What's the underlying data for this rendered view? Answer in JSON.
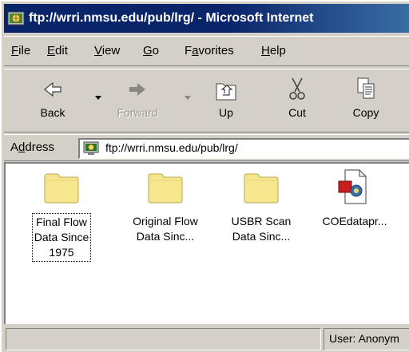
{
  "window": {
    "title": "ftp://wrri.nmsu.edu/pub/lrg/ - Microsoft Internet"
  },
  "menu": {
    "items": [
      {
        "label": "File",
        "underline": "F"
      },
      {
        "label": "Edit",
        "underline": "E"
      },
      {
        "label": "View",
        "underline": "V"
      },
      {
        "label": "Go",
        "underline": "G"
      },
      {
        "label": "Favorites",
        "underline": "a"
      },
      {
        "label": "Help",
        "underline": "H"
      }
    ]
  },
  "toolbar": {
    "back_label": "Back",
    "forward_label": "Forward",
    "up_label": "Up",
    "cut_label": "Cut",
    "copy_label": "Copy"
  },
  "address": {
    "label": "Address",
    "value": "ftp://wrri.nmsu.edu/pub/lrg/"
  },
  "files": [
    {
      "name": "Final Flow Data Since 1975",
      "lines": [
        "Final Flow",
        "Data Since",
        "1975"
      ],
      "type": "folder",
      "selected": true
    },
    {
      "name": "Original Flow Data Sinc...",
      "lines": [
        "Original Flow",
        "Data Sinc..."
      ],
      "type": "folder",
      "selected": false
    },
    {
      "name": "USBR Scan Data Sinc...",
      "lines": [
        "USBR Scan",
        "Data Sinc..."
      ],
      "type": "folder",
      "selected": false
    },
    {
      "name": "COEdatapr...",
      "lines": [
        "COEdatapr..."
      ],
      "type": "document",
      "selected": false
    }
  ],
  "status": {
    "left_text": "",
    "right_text": "User: Anonym"
  },
  "colors": {
    "titlebar": "#0a246a",
    "window_face": "#d4d0c8",
    "folder": "#f6e68e"
  },
  "icons": {
    "app": "ie-globe-icon",
    "back": "back-arrow-icon",
    "forward": "forward-arrow-icon",
    "up": "up-folder-icon",
    "cut": "scissors-icon",
    "copy": "copy-icon",
    "address": "ftp-site-icon",
    "folder": "folder-icon",
    "document": "document-icon"
  }
}
